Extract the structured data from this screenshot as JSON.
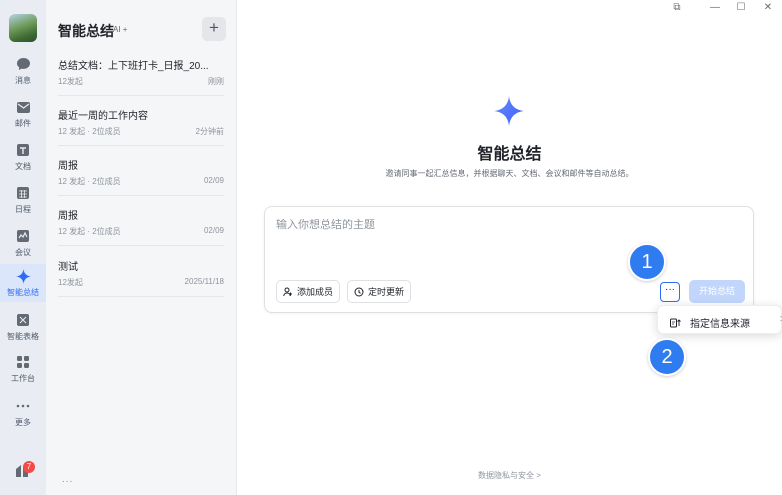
{
  "nav": {
    "items": [
      {
        "label": "消息",
        "icon": "chat-bubble-icon"
      },
      {
        "label": "邮件",
        "icon": "mail-icon"
      },
      {
        "label": "文档",
        "icon": "doc-icon"
      },
      {
        "label": "日程",
        "icon": "calendar-icon"
      },
      {
        "label": "会议",
        "icon": "meeting-icon"
      },
      {
        "label": "智能总结",
        "icon": "sparkle-icon",
        "active": true
      },
      {
        "label": "智能表格",
        "icon": "sheet-icon"
      },
      {
        "label": "工作台",
        "icon": "grid-icon"
      },
      {
        "label": "更多",
        "icon": "more-dots-icon"
      }
    ],
    "badge_count": "7",
    "accent": "#2f6cf6"
  },
  "list": {
    "title": "智能总结",
    "ai_tag": "AI +",
    "new_button": "+",
    "more": "...",
    "entries": [
      {
        "title": "总结文档：上下班打卡_日报_20...",
        "sub": "12发起",
        "time": "刚刚"
      },
      {
        "title": "最近一周的工作内容",
        "sub": "12 发起 · 2位成员",
        "time": "2分钟前"
      },
      {
        "title": "周报",
        "sub": "12 发起 · 2位成员",
        "time": "02/09"
      },
      {
        "title": "周报",
        "sub": "12 发起 · 2位成员",
        "time": "02/09"
      },
      {
        "title": "测试",
        "sub": "12发起",
        "time": "2025/11/18"
      }
    ]
  },
  "main": {
    "title": "智能总结",
    "subtitle": "邀请同事一起汇总信息，并根据聊天、文档、会议和邮件等自动总结。",
    "input_placeholder": "输入你想总结的主题",
    "add_member": "添加成员",
    "schedule_update": "定时更新",
    "more_button": "···",
    "start_button": "开始总结",
    "popup_item": "指定信息来源",
    "popup_arrow": ">",
    "marker_1": "1",
    "marker_2": "2",
    "footer": "数据隐私与安全 >"
  },
  "window_controls": {
    "restore": "⧉",
    "minimize": "—",
    "maximize": "☐",
    "close": "✕"
  }
}
